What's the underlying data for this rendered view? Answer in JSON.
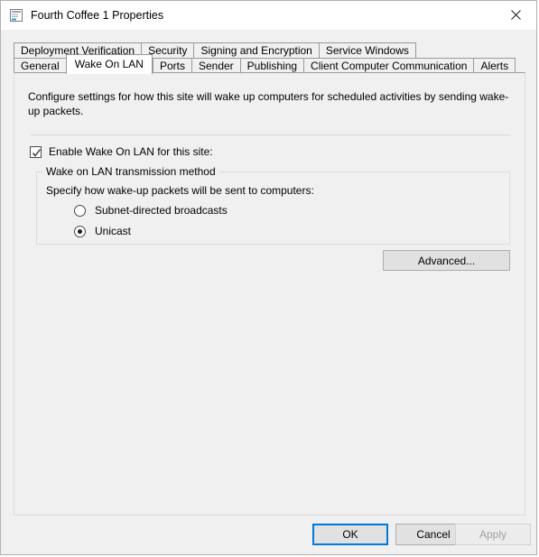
{
  "window": {
    "title": "Fourth Coffee 1 Properties",
    "icon": "properties-window-icon",
    "close_label": "✕"
  },
  "tabs": {
    "row1": [
      {
        "label": "Deployment Verification",
        "active": false
      },
      {
        "label": "Security",
        "active": false
      },
      {
        "label": "Signing and Encryption",
        "active": false
      },
      {
        "label": "Service Windows",
        "active": false
      }
    ],
    "row2": [
      {
        "label": "General",
        "active": false
      },
      {
        "label": "Wake On LAN",
        "active": true
      },
      {
        "label": "Ports",
        "active": false
      },
      {
        "label": "Sender",
        "active": false
      },
      {
        "label": "Publishing",
        "active": false
      },
      {
        "label": "Client Computer Communication",
        "active": false
      },
      {
        "label": "Alerts",
        "active": false
      }
    ]
  },
  "page": {
    "description": "Configure settings for how this site will wake up computers for scheduled activities by sending wake-up packets.",
    "enable_checkbox": {
      "label": "Enable Wake On LAN for this site:",
      "checked": true
    },
    "group": {
      "legend": "Wake on LAN transmission method",
      "sub_label": "Specify how wake-up packets will be sent to computers:",
      "options": [
        {
          "label": "Subnet-directed broadcasts",
          "selected": false
        },
        {
          "label": "Unicast",
          "selected": true
        }
      ]
    },
    "advanced_button": "Advanced..."
  },
  "footer": {
    "ok": "OK",
    "cancel": "Cancel",
    "apply": "Apply",
    "apply_disabled": true
  },
  "colors": {
    "dialog_bg": "#f0f0f0",
    "titlebar_bg": "#ffffff",
    "active_tab_bg": "#ffffff",
    "focus_border": "#0078d7",
    "disabled_text": "#a0a0a0"
  }
}
